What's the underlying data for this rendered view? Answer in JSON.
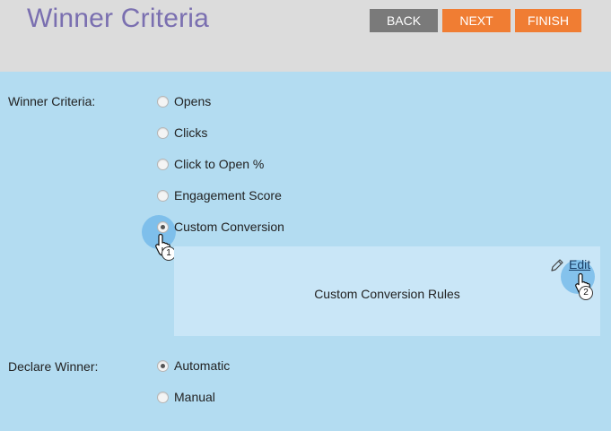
{
  "header": {
    "title": "Winner Criteria",
    "buttons": {
      "back": "BACK",
      "next": "NEXT",
      "finish": "FINISH"
    }
  },
  "winner_criteria": {
    "label": "Winner Criteria:",
    "options": [
      "Opens",
      "Clicks",
      "Click to Open %",
      "Engagement Score",
      "Custom Conversion"
    ],
    "selected": "Custom Conversion"
  },
  "custom_conversion_panel": {
    "edit_label": "Edit",
    "rules_text": "Custom Conversion Rules"
  },
  "declare_winner": {
    "label": "Declare Winner:",
    "options": [
      "Automatic",
      "Manual"
    ],
    "selected": "Automatic"
  },
  "callouts": {
    "step1": "1",
    "step2": "2"
  },
  "colors": {
    "background": "#b3dcf1",
    "header_bg": "#dcdcdc",
    "title": "#7a6fb0",
    "back_button": "#7a7a7a",
    "accent_button": "#f07d33",
    "panel_bg": "#c9e6f7",
    "highlight": "#6cb5e8"
  }
}
